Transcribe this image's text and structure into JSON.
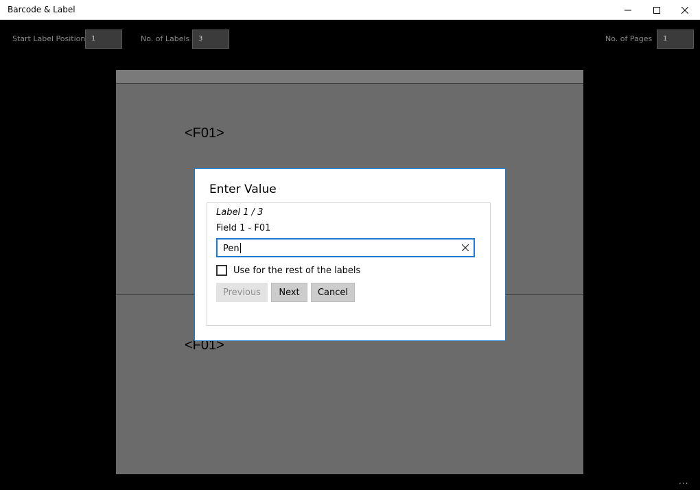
{
  "window": {
    "title": "Barcode & Label",
    "controls": [
      "minimize-icon",
      "maximize-icon",
      "close-icon"
    ]
  },
  "toolbar": {
    "start_label_position": {
      "label": "Start Label Position",
      "value": "1"
    },
    "no_of_labels": {
      "label": "No. of Labels",
      "value": "3"
    },
    "no_of_pages": {
      "label": "No. of Pages",
      "value": "1"
    }
  },
  "canvas": {
    "placeholders": [
      "<F01>",
      "<F01>"
    ]
  },
  "dialog": {
    "title": "Enter Value",
    "label_counter": "Label 1 / 3",
    "field_name": "Field 1 - F01",
    "input_value": "Pen",
    "clear_icon": "close-icon",
    "checkbox_label": "Use for the rest of the labels",
    "checkbox_checked": false,
    "buttons": {
      "previous": "Previous",
      "next": "Next",
      "cancel": "Cancel"
    },
    "accent_color": "#1e7ad1"
  },
  "more_button": "..."
}
